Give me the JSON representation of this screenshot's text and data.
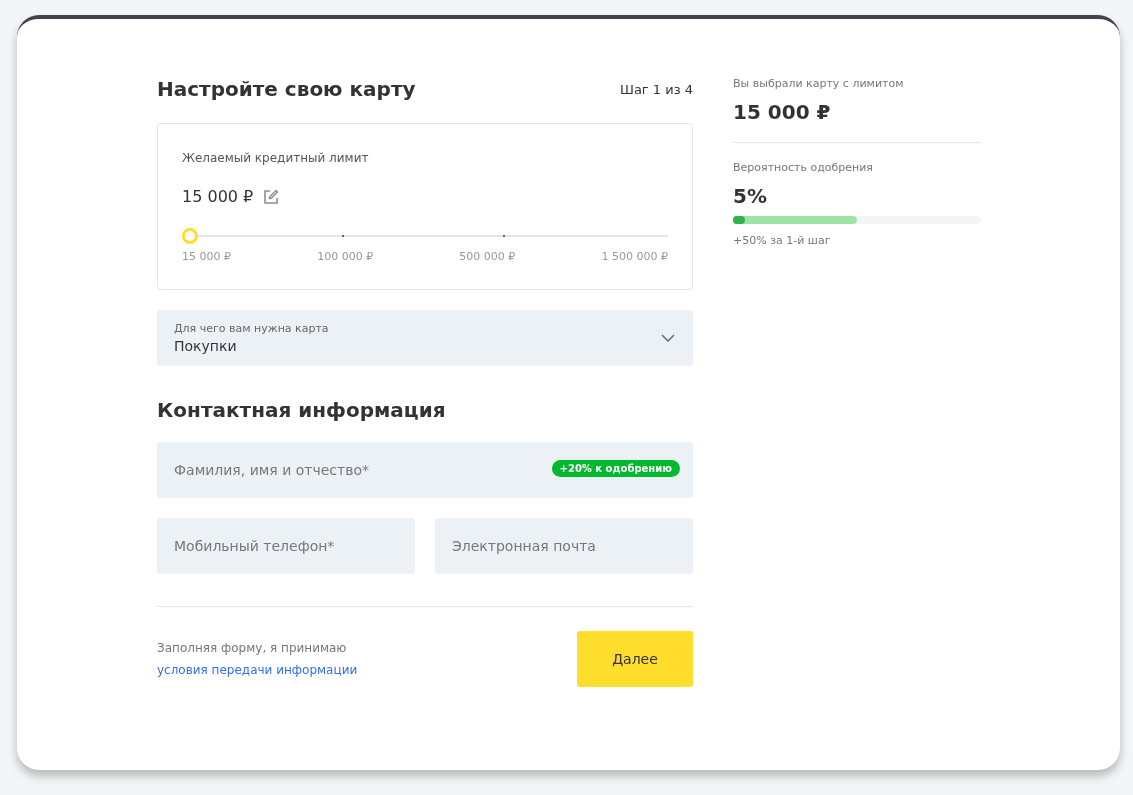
{
  "form": {
    "title": "Настройте свою карту",
    "step": "Шаг 1 из 4",
    "limit": {
      "label": "Желаемый кредитный лимит",
      "value": "15 000 ₽",
      "slider": {
        "level": 0
      },
      "ticks": [
        "15 000 ₽",
        "100 000 ₽",
        "500 000 ₽",
        "1 500 000 ₽"
      ]
    },
    "purpose": {
      "label": "Для чего вам нужна карта",
      "value": "Покупки"
    },
    "contact_title": "Контактная информация",
    "fields": [
      {
        "placeholder": "Фамилия, имя и отчество*",
        "badge": "+20% к одобрению"
      },
      {
        "placeholder": "Мобильный телефон*"
      },
      {
        "placeholder": "Электронная почта"
      }
    ],
    "consent": {
      "text": "Заполняя форму, я принимаю",
      "link": "условия передачи информации"
    },
    "button": "Далее"
  },
  "summary": {
    "limit_label": "Вы выбрали карту с лимитом",
    "limit_value": "15 000 ₽",
    "approval_label": "Вероятность одобрения",
    "approval_value": "5%",
    "approval": {
      "level": 0.05
    },
    "bonus": {
      "level": 0.5
    },
    "bonus_text": "+50% за 1-й шаг"
  }
}
